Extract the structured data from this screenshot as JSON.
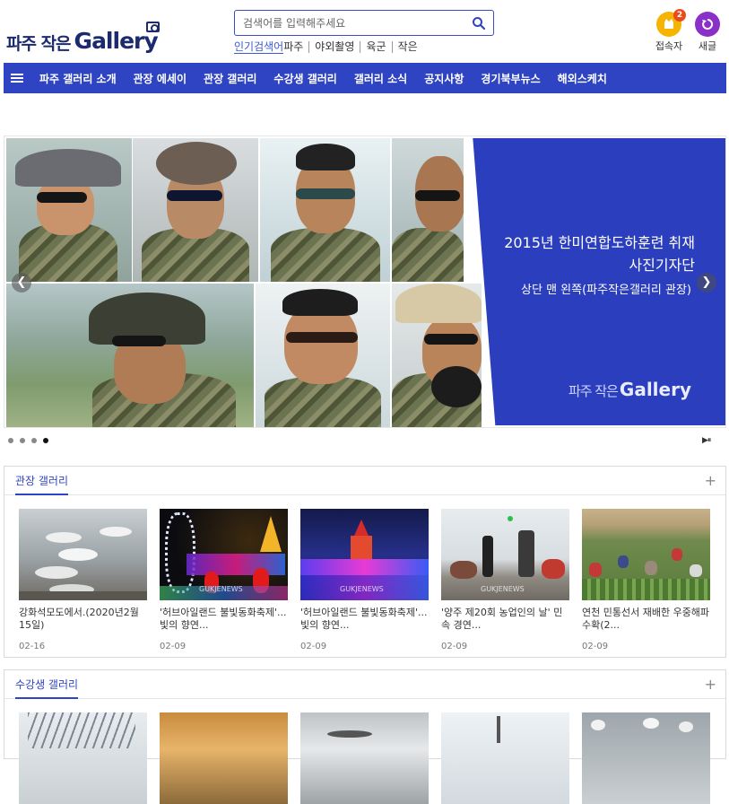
{
  "header": {
    "logo_ko": "파주 작은",
    "logo_en": "Gallery",
    "search_placeholder": "검색어를 입력해주세요",
    "popular_label": "인기검색어",
    "popular_terms": [
      "파주",
      "야외촬영",
      "육군",
      "작은"
    ],
    "visitors_label": "접속자",
    "visitors_count": "2",
    "new_posts_label": "새글",
    "colors": {
      "brand": "#1c2a6e",
      "accent": "#2f44c2",
      "visitors": "#f4b400",
      "new_posts": "#8b2fc9"
    }
  },
  "nav": {
    "menu_icon": "hamburger-icon",
    "items": [
      "파주 갤러리 소개",
      "관장 에세이",
      "관장 갤러리",
      "수강생 갤러리",
      "갤러리 소식",
      "공지사항",
      "경기북부뉴스",
      "해외스케치"
    ]
  },
  "slider": {
    "title_line1": "2015년 한미연합도하훈련 취재",
    "title_line2": "사진기자단",
    "subtitle": "상단 맨 왼쪽(파주작은갤러리 관장)",
    "logo_ko": "파주 작은",
    "logo_en": "Gallery",
    "prev_icon": "chevron-left-icon",
    "next_icon": "chevron-right-icon",
    "dot_count": 4,
    "active_dot": 4,
    "controls": "▶⏸"
  },
  "sections": [
    {
      "title": "관장 갤러리",
      "more_icon": "plus-icon",
      "cards": [
        {
          "title": "강화석모도에서.(2020년2월 15일)",
          "date": "02-16"
        },
        {
          "title": "'허브아일랜드 불빛동화축제'...빛의 향연...",
          "date": "02-09"
        },
        {
          "title": "'허브아일랜드 불빛동화축제'...빛의 향연...",
          "date": "02-09"
        },
        {
          "title": "'양주 제20회 농업인의 날' 민속 경연...",
          "date": "02-09"
        },
        {
          "title": "연천 민통선서 재배한 우중해파 수확(2...",
          "date": "02-09"
        }
      ]
    },
    {
      "title": "수강생 갤러리",
      "more_icon": "plus-icon",
      "cards": []
    }
  ]
}
